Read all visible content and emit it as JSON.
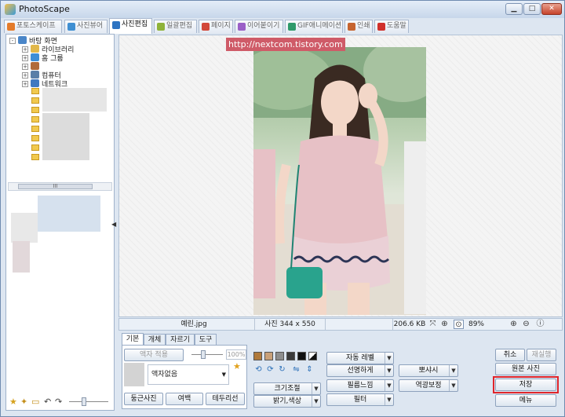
{
  "window": {
    "title": "PhotoScape",
    "controls": [
      "minimize",
      "maximize",
      "close"
    ]
  },
  "tabs": [
    {
      "label": "포토스케이프",
      "color": "#e47b2a"
    },
    {
      "label": "사진뷰어",
      "color": "#3f8fd2"
    },
    {
      "label": "사진편집",
      "color": "#2d74c2",
      "active": true
    },
    {
      "label": "일괄편집",
      "color": "#8fb33a"
    },
    {
      "label": "페이지",
      "color": "#d2483a"
    },
    {
      "label": "이어붙이기",
      "color": "#9a5fc7"
    },
    {
      "label": "GIF애니메이션",
      "color": "#2f9a6a"
    },
    {
      "label": "인쇄",
      "color": "#c6642f"
    },
    {
      "label": "도움말",
      "color": "#d0302b"
    }
  ],
  "tree": {
    "items": [
      {
        "label": "바탕 화면",
        "expander": "-",
        "color": "#4a86c8"
      },
      {
        "label": "라이브러리",
        "expander": "+",
        "color": "#e2b84a"
      },
      {
        "label": "홈 그룹",
        "expander": "+",
        "color": "#3e8ed6"
      },
      {
        "label": "",
        "expander": "+",
        "color": "#b06a3a"
      },
      {
        "label": "컴퓨터",
        "expander": "+",
        "color": "#5a7fa8"
      },
      {
        "label": "네트워크",
        "expander": "+",
        "color": "#3e78c0"
      }
    ],
    "scrollbar_label": "III"
  },
  "watermark": "http://nextcom.tistory.com",
  "status": {
    "filename": "예린.jpg",
    "dimensions": "사진 344 x 550",
    "filesize": "206.6 KB",
    "zoom": "89%"
  },
  "edit_tabs": [
    "기본",
    "개체",
    "자르기",
    "도구"
  ],
  "frame": {
    "apply_label": "액자 적용",
    "percent": "100%",
    "selected": "액자없음",
    "buttons": [
      "둥근사진",
      "여백",
      "테두리선"
    ]
  },
  "buttons": {
    "auto_level": "자동 레벨",
    "sharpen": "선명하게",
    "bloom": "뽀샤시",
    "resize": "크기조절",
    "film": "필름느낌",
    "backlight": "역광보정",
    "brightness": "밝기,색상",
    "filter": "필터",
    "cancel": "취소",
    "redo": "재실행",
    "original": "원본 사진",
    "save": "저장",
    "menu": "메뉴"
  },
  "highlight_color": "#e0252b"
}
